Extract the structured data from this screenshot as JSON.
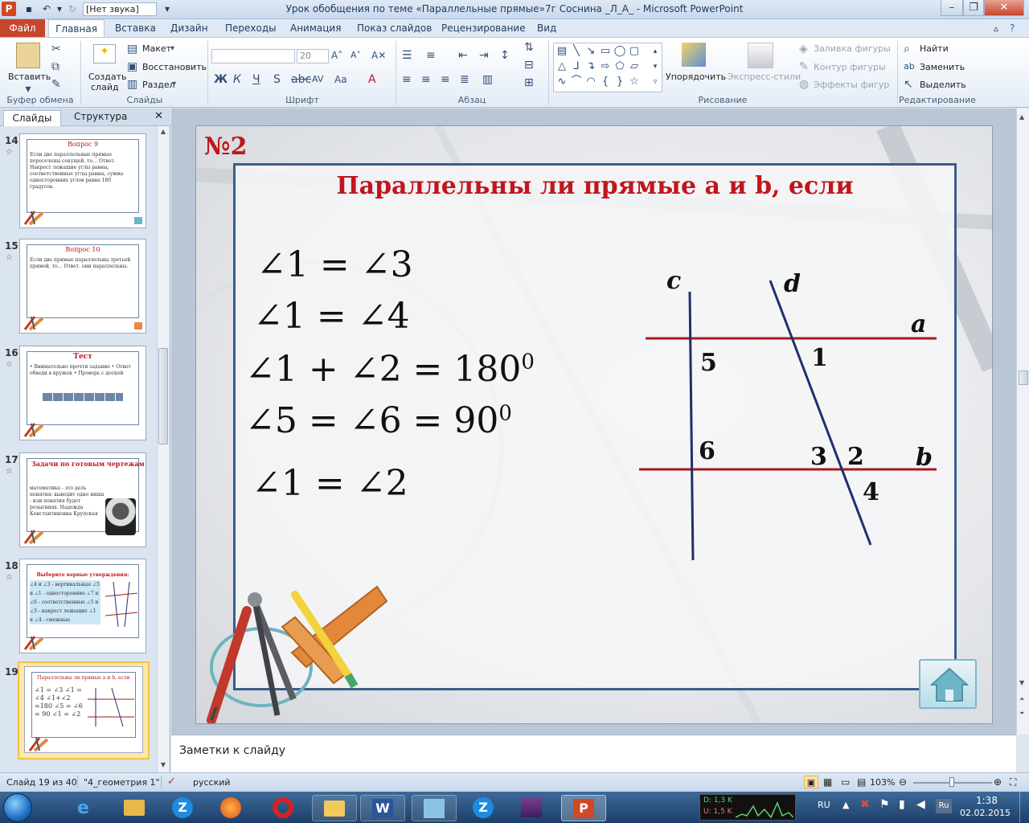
{
  "window": {
    "title": "Урок обобщения по теме «Параллельные прямые»7г Соснина _Л_А_ - Microsoft PowerPoint",
    "app_icon": "P",
    "sound_box": "[Нет звука]"
  },
  "tabs": [
    "Файл",
    "Главная",
    "Вставка",
    "Дизайн",
    "Переходы",
    "Анимация",
    "Показ слайдов",
    "Рецензирование",
    "Вид"
  ],
  "ribbon": {
    "clipboard": {
      "paste": "Вставить",
      "label": "Буфер обмена"
    },
    "slides": {
      "create1": "Создать",
      "create2": "слайд",
      "layout": "Макет",
      "reset": "Восстановить",
      "section": "Раздел",
      "label": "Слайды"
    },
    "font": {
      "size": "20",
      "bold": "Ж",
      "italic": "К",
      "underline": "Ч",
      "strike": "S",
      "label": "Шрифт"
    },
    "paragraph": {
      "label": "Абзац"
    },
    "drawing": {
      "arrange": "Упорядочить",
      "styles": "Экспресс-стили",
      "fill": "Заливка фигуры",
      "outline": "Контур фигуры",
      "effects": "Эффекты фигур",
      "label": "Рисование"
    },
    "editing": {
      "find": "Найти",
      "replace": "Заменить",
      "select": "Выделить",
      "label": "Редактирование"
    }
  },
  "left_panel": {
    "tabs": [
      "Слайды",
      "Структура"
    ],
    "thumbnails": [
      {
        "num": "14",
        "title": "Вопрос 9",
        "text": "Если две параллельные прямые пересечены секущей, то… Ответ. Накрест лежащие углы равны, соответственные углы равны, сумма односторонних углов равна 180 градусов."
      },
      {
        "num": "15",
        "title": "Вопрос 10",
        "text": "Если две прямые параллельны третьей прямой, то… Ответ. они параллельны."
      },
      {
        "num": "16",
        "title": "Тест",
        "text": "• Внимательно прочти задание • Ответ обведи в кружок • Проверь с доской"
      },
      {
        "num": "17",
        "title": "Задачи по готовым чертежам",
        "text": "математика - это дель понятия: выводит одно ниша - изи понятия будет розыгниях. Надежда Константиновна Крупская"
      },
      {
        "num": "18",
        "title": "Выберите верные утверждения:",
        "text": "∠4 и ∠3 - вертикальные ∠5 и ∠1 - односторонние ∠7 и ∠6 - соответственные ∠5 и ∠3 - накрест лежащие ∠1 и ∠4 - смежные"
      },
      {
        "num": "19",
        "title": "Параллельны ли прямые a и b, если",
        "text": "∠1 = ∠3 ∠1 = ∠4 ∠1+∠2 =180 ∠5 = ∠6 = 90 ∠1 = ∠2"
      }
    ]
  },
  "slide": {
    "number_label": "№2",
    "title": "Параллельны ли прямые a и b, если",
    "conditions": [
      {
        "text": "∠1 = ∠3",
        "sup": ""
      },
      {
        "text": "∠1 = ∠4",
        "sup": ""
      },
      {
        "text": "∠1 + ∠2 = 180",
        "sup": "0"
      },
      {
        "text": "∠5 = ∠6 = 90",
        "sup": "0"
      },
      {
        "text": "∠1 = ∠2",
        "sup": ""
      }
    ],
    "line_labels": {
      "c": "c",
      "d": "d",
      "a": "a",
      "b": "b"
    },
    "angle_labels": {
      "a1": "1",
      "a2": "2",
      "a3": "3",
      "a4": "4",
      "a5": "5",
      "a6": "6"
    },
    "colors": {
      "title": "#c0161d",
      "line_ab": "#a21a1f",
      "line_cd": "#1f2f6e",
      "frame": "#3c5d89"
    }
  },
  "notes_placeholder": "Заметки к слайду",
  "status": {
    "slide": "Слайд 19 из 40",
    "theme": "\"4_геометрия 1\"",
    "lang": "русский",
    "zoom": "103%"
  },
  "taskbar": {
    "lang": "RU",
    "time": "1:38",
    "date": "02.02.2015",
    "net_d": "D: 1,3 K",
    "net_u": "U: 1,5 K"
  }
}
